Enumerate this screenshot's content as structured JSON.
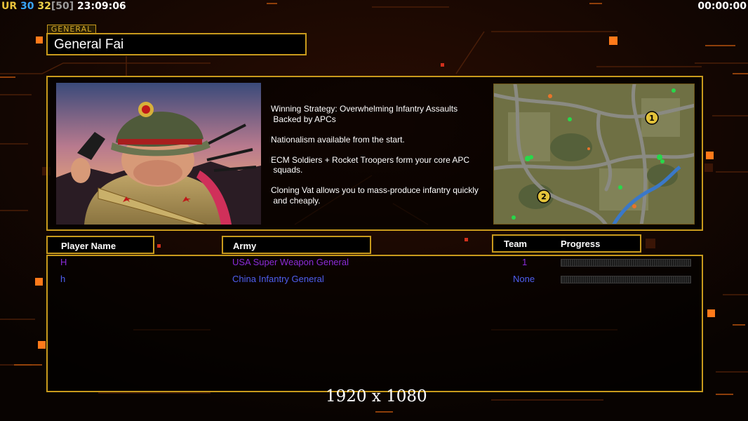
{
  "hud": {
    "left": [
      {
        "text": "UR",
        "color": "#e9c23a"
      },
      {
        "text": " 30",
        "color": "#39a6ff"
      },
      {
        "text": " 32",
        "color": "#f0d24a"
      },
      {
        "text": "[50]",
        "color": "#9a9a9a"
      },
      {
        "text": " 23:09:06",
        "color": "#ffffff"
      }
    ],
    "right": "00:00:00"
  },
  "general": {
    "tag": "GENERAL",
    "name": "General Fai",
    "strategy": [
      "Winning Strategy: Overwhelming Infantry Assaults\n Backed by APCs",
      "Nationalism available from the start.",
      "ECM Soldiers + Rocket Troopers form your core APC\n squads.",
      "Cloning Vat allows you to mass-produce infantry quickly\n and cheaply."
    ]
  },
  "map": {
    "start_positions": [
      "1",
      "2"
    ]
  },
  "columns": {
    "player_name": "Player Name",
    "army": "Army",
    "team": "Team",
    "progress": "Progress"
  },
  "players": [
    {
      "name": "H",
      "army": "USA Super Weapon General",
      "team": "1",
      "color": "#8a2bd8"
    },
    {
      "name": "h",
      "army": "China Infantry General",
      "team": "None",
      "color": "#4f5ff0"
    }
  ],
  "watermark": "1920 x 1080",
  "colors": {
    "frame": "#c89a1c",
    "accent": "#ff7a1a"
  }
}
